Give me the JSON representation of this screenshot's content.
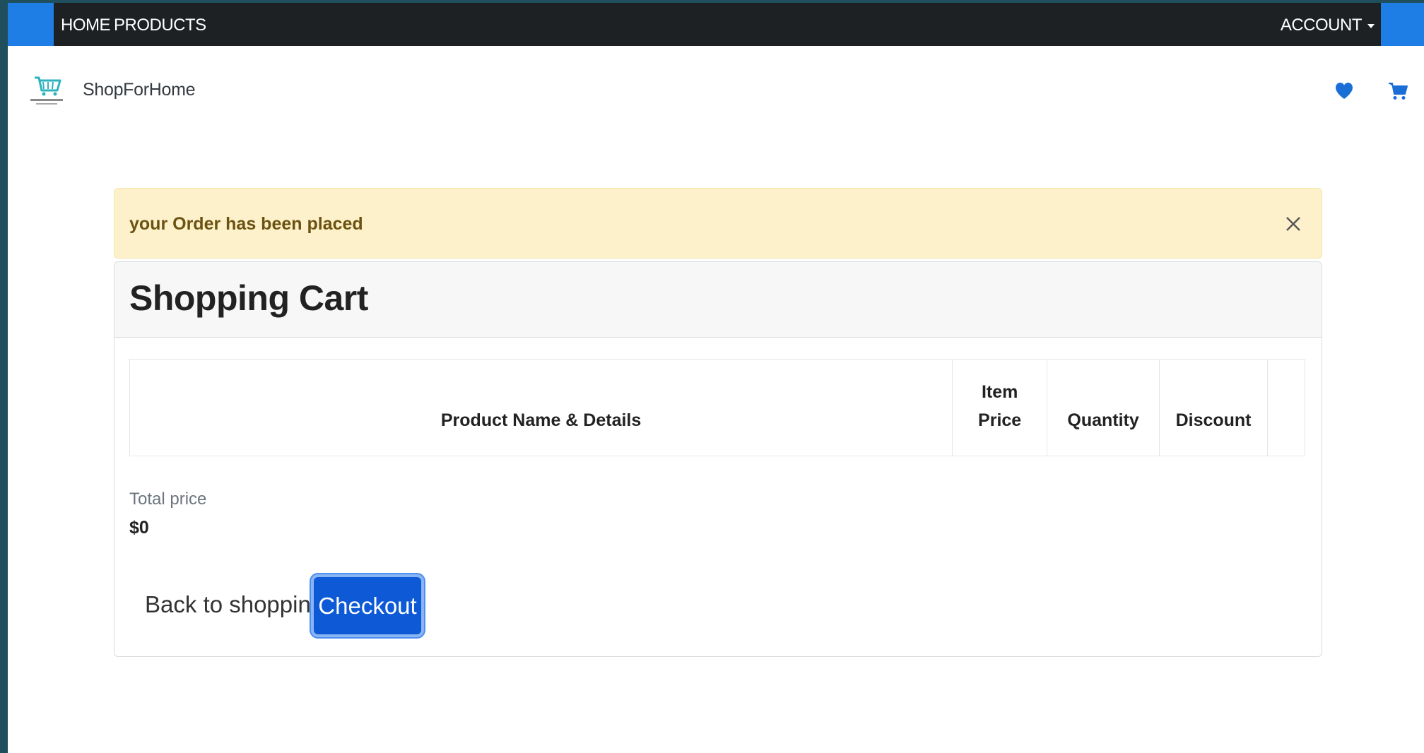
{
  "nav": {
    "home_label": "HOME",
    "products_label": "PRODUCTS",
    "account_label": "ACCOUNT"
  },
  "brand": {
    "name": "ShopForHome",
    "logo_icon": "shopping-cart-logo"
  },
  "header_icons": {
    "wishlist_icon": "heart-icon",
    "cart_icon": "cart-icon"
  },
  "alert": {
    "message": "your Order has been placed",
    "close_icon": "close-icon"
  },
  "cart": {
    "title": "Shopping Cart",
    "columns": [
      "Product Name & Details",
      "Item Price",
      "Quantity",
      "Discount",
      ""
    ],
    "rows": [],
    "total_label": "Total price",
    "total_value": "$0",
    "back_label": "Back to shopping",
    "checkout_label": "Checkout"
  },
  "colors": {
    "navbar": "#1e2124",
    "accent": "#1f7de6",
    "alert_bg": "#fdf1cc",
    "alert_text": "#6b5210",
    "checkout_bg": "#0d59d6",
    "icon_blue": "#1a6fd6"
  }
}
